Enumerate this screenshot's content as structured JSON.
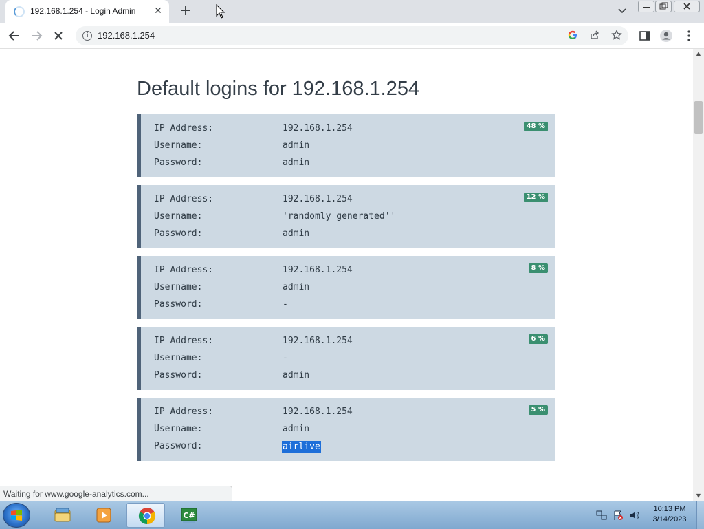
{
  "browser": {
    "tab_title": "192.168.1.254 - Login Admin",
    "new_tab_symbol": "+",
    "close_tab_symbol": "✕",
    "url": "192.168.1.254",
    "loading": true,
    "icons": [
      "back-icon",
      "forward-icon",
      "stop-icon",
      "info-icon",
      "google-icon",
      "share-icon",
      "star-icon",
      "side-panel-icon",
      "profile-icon",
      "menu-icon"
    ]
  },
  "page": {
    "title": "Default logins for 192.168.1.254",
    "field_labels": {
      "ip": "IP Address:",
      "username": "Username:",
      "password": "Password:"
    },
    "entries": [
      {
        "ip": "192.168.1.254",
        "username": "admin",
        "password": "admin",
        "percent": "48 %"
      },
      {
        "ip": "192.168.1.254",
        "username": "'randomly generated''",
        "password": "admin",
        "percent": "12 %"
      },
      {
        "ip": "192.168.1.254",
        "username": "admin",
        "password": "-",
        "percent": "8 %"
      },
      {
        "ip": "192.168.1.254",
        "username": "-",
        "password": "admin",
        "percent": "6 %"
      },
      {
        "ip": "192.168.1.254",
        "username": "admin",
        "password": "airlive",
        "percent": "5 %",
        "password_selected": true
      }
    ],
    "badge_color": "#3a8f70",
    "card_color": "#cdd9e3",
    "selection_color": "#1e6fd9"
  },
  "status_bar": {
    "text": "Waiting for www.google-analytics.com..."
  },
  "taskbar": {
    "apps": [
      "windows-explorer",
      "media-player",
      "google-chrome",
      "csharp-editor"
    ],
    "active_app": "google-chrome",
    "clock_time": "10:13 PM",
    "clock_date": "3/14/2023"
  }
}
